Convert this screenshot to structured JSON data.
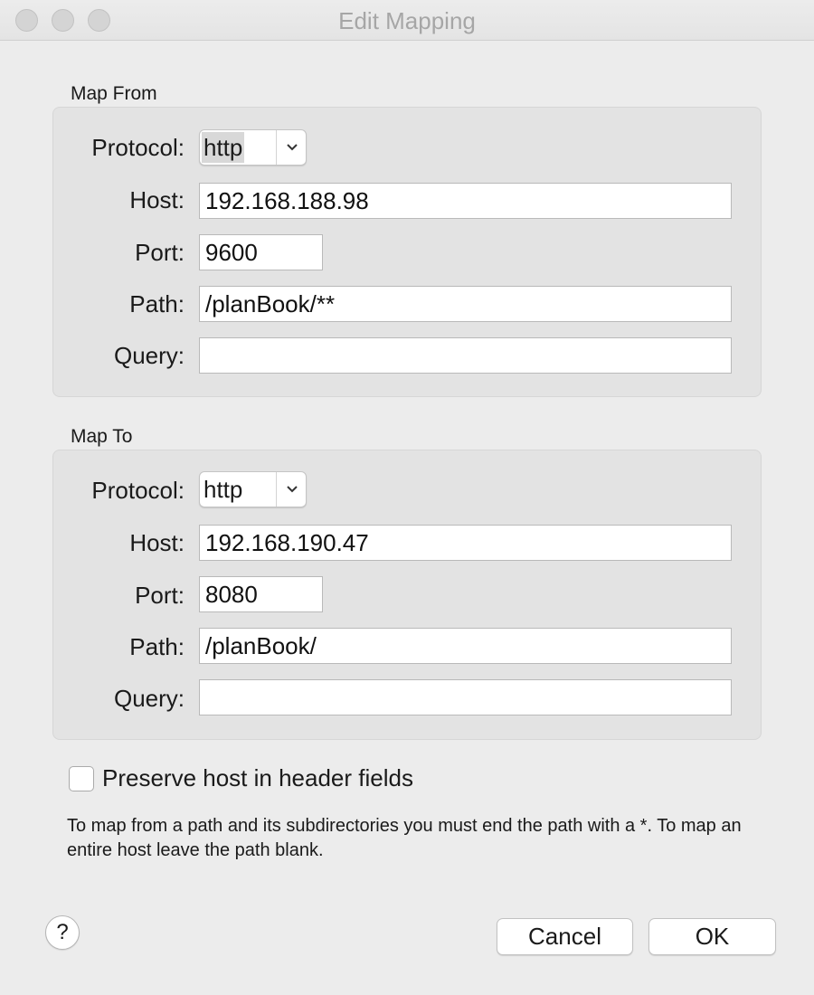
{
  "window": {
    "title": "Edit Mapping"
  },
  "map_from": {
    "section_label": "Map From",
    "protocol_label": "Protocol:",
    "protocol_value": "http",
    "host_label": "Host:",
    "host_value": "192.168.188.98",
    "port_label": "Port:",
    "port_value": "9600",
    "path_label": "Path:",
    "path_value": "/planBook/**",
    "query_label": "Query:",
    "query_value": ""
  },
  "map_to": {
    "section_label": "Map To",
    "protocol_label": "Protocol:",
    "protocol_value": "http",
    "host_label": "Host:",
    "host_value": "192.168.190.47",
    "port_label": "Port:",
    "port_value": "8080",
    "path_label": "Path:",
    "path_value": "/planBook/",
    "query_label": "Query:",
    "query_value": ""
  },
  "options": {
    "preserve_host_label": "Preserve host in header fields",
    "preserve_host_checked": false
  },
  "help_text": "To map from a path and its subdirectories you must end the path with a *. To map an entire host leave the path blank.",
  "footer": {
    "help_button": "?",
    "cancel_label": "Cancel",
    "ok_label": "OK"
  }
}
